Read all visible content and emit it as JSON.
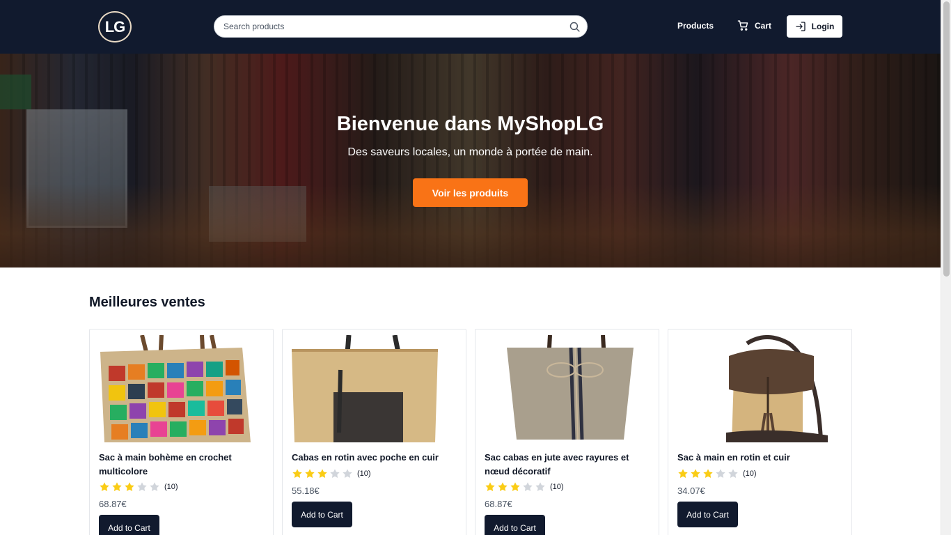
{
  "header": {
    "logo_text": "LG",
    "search_placeholder": "Search products",
    "nav_products": "Products",
    "nav_cart": "Cart",
    "login_label": "Login"
  },
  "hero": {
    "title": "Bienvenue dans MyShopLG",
    "subtitle": "Des saveurs locales, un monde à portée de main.",
    "cta_label": "Voir les produits"
  },
  "best_sellers": {
    "title": "Meilleures ventes",
    "products": [
      {
        "name": "Sac à main bohème en crochet multicolore",
        "rating": 3,
        "rating_max": 5,
        "review_count": "(10)",
        "price": "68.87€",
        "add_label": "Add to Cart"
      },
      {
        "name": "Cabas en rotin avec poche en cuir",
        "rating": 3,
        "rating_max": 5,
        "review_count": "(10)",
        "price": "55.18€",
        "add_label": "Add to Cart"
      },
      {
        "name": "Sac cabas en jute avec rayures et nœud décoratif",
        "rating": 3,
        "rating_max": 5,
        "review_count": "(10)",
        "price": "68.87€",
        "add_label": "Add to Cart"
      },
      {
        "name": "Sac à main en rotin et cuir",
        "rating": 3,
        "rating_max": 5,
        "review_count": "(10)",
        "price": "34.07€",
        "add_label": "Add to Cart"
      }
    ]
  },
  "colors": {
    "header_bg": "#111a2e",
    "accent": "#f97316",
    "star_filled": "#facc15",
    "star_empty": "#d1d5db",
    "button_dark": "#111a2e"
  }
}
